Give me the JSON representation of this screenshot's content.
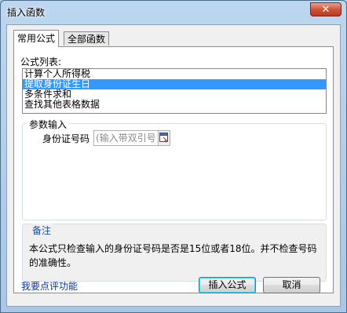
{
  "window": {
    "title": "插入函数",
    "close_glyph": "✕"
  },
  "tabs": [
    {
      "label": "常用公式",
      "active": true
    },
    {
      "label": "全部函数",
      "active": false
    }
  ],
  "formula_list": {
    "label": "公式列表:",
    "items": [
      "计算个人所得税",
      "提取身份证生日",
      "多条件求和",
      "查找其他表格数据"
    ],
    "selected_index": 1
  },
  "params": {
    "group_label": "参数输入",
    "field_label": "身份证号码",
    "placeholder": "(输入带双引号"
  },
  "note": {
    "title": "备注",
    "text": "本公式只检查输入的身份证号码是否是15位或者18位。并不检查号码的准确性。"
  },
  "footer": {
    "feedback_link": "我要点评功能",
    "insert_label": "插入公式",
    "cancel_label": "取消"
  },
  "colors": {
    "selection": "#3399ff",
    "link": "#0b33a3",
    "note_title": "#1c4fa0"
  },
  "icons": {
    "picker": "range-picker-icon",
    "close": "close-icon"
  }
}
